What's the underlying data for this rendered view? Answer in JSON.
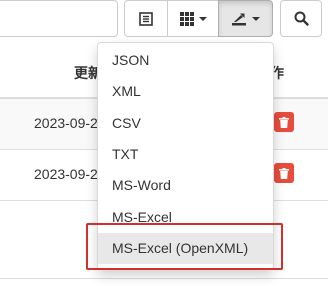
{
  "table": {
    "headers": {
      "col_date": "更新",
      "col_action": "作"
    },
    "rows": [
      {
        "date": "2023-09-2"
      },
      {
        "date": "2023-09-2"
      }
    ]
  },
  "toolbar": {
    "list_icon": "list-icon",
    "columns_icon": "grid-icon",
    "export_icon": "export-icon",
    "search_icon": "search-icon"
  },
  "export_menu": {
    "items": [
      "JSON",
      "XML",
      "CSV",
      "TXT",
      "MS-Word",
      "MS-Excel",
      "MS-Excel (OpenXML)"
    ],
    "highlighted": "MS-Excel (OpenXML)"
  },
  "colors": {
    "delete": "#e74c3c",
    "highlight_border": "#d32f2f"
  }
}
